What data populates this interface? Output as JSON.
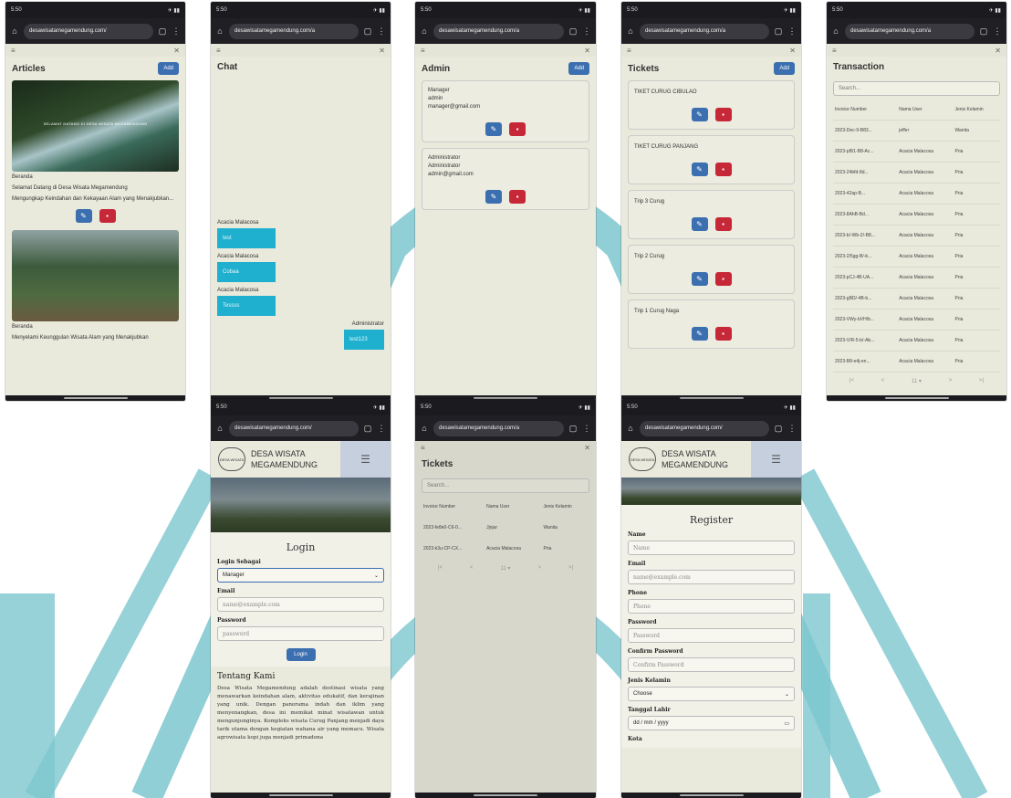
{
  "browser": {
    "url_a": "desawisatamegamendung.com/",
    "url_b": "desawisatamegamendung.com/a",
    "url_c": "desawisatamegamendung.com/a",
    "time_a": "5:50",
    "time_b": "5:50",
    "time_c": "5:50"
  },
  "articles": {
    "title": "Articles",
    "add": "Add",
    "items": [
      {
        "category": "Beranda",
        "title": "Selamat Datang di Desa Wisata Megamendung",
        "desc": "Mengungkap Keindahan dan Kekayaan Alam yang Menakjubkan...",
        "img_caption": "SELAMAT DATANG DI DESA WISATA MEGAMENDUNG"
      },
      {
        "category": "Beranda",
        "title": "Menyelami Keunggulan Wisata Alam yang Menakjubkan",
        "desc": ""
      }
    ]
  },
  "chat": {
    "title": "Chat",
    "messages": [
      {
        "sender": "Acacia Malacosa",
        "text": "test"
      },
      {
        "sender": "Acacia Malacosa",
        "text": "Cobaa"
      },
      {
        "sender": "Acacia Malacosa",
        "text": "Tessss"
      }
    ],
    "reply": {
      "sender": "Administrator",
      "text": "test123"
    }
  },
  "admin": {
    "title": "Admin",
    "add": "Add",
    "items": [
      {
        "name": "Manager",
        "role": "admin",
        "email": "manager@gmail.com"
      },
      {
        "name": "Administrator",
        "role": "Administrator",
        "email": "admin@gmail.com"
      }
    ]
  },
  "tickets": {
    "title": "Tickets",
    "add": "Add",
    "items": [
      "TIKET CURUG CIBULAO",
      "TIKET CURUG PANJANG",
      "Trip 3 Curug",
      "Trip 2 Curug",
      "Trip 1 Curug Naga"
    ]
  },
  "transaction": {
    "title": "Transaction",
    "search_placeholder": "Search...",
    "headers": [
      "Invoice Number",
      "Nama User",
      "Jenis Kelamin"
    ],
    "rows": [
      [
        "2023-Dec-9-B83...",
        "jeffer",
        "Wanita"
      ],
      [
        "2023-pB/1-B8-Ac...",
        "Acacia Malacosa",
        "Pria"
      ],
      [
        "2023-24bfd-8d...",
        "Acacia Malacosa",
        "Pria"
      ],
      [
        "2023-42ap-B...",
        "Acacia Malacosa",
        "Pria"
      ],
      [
        "2023-8AhB-Bd...",
        "Acacia Malacosa",
        "Pria"
      ],
      [
        "2023-b/-Wb-2/-B8...",
        "Acacia Malacosa",
        "Pria"
      ],
      [
        "2023-2/5gg-B/-b...",
        "Acacia Malacosa",
        "Pria"
      ],
      [
        "2023-pCJ-4B-UA...",
        "Acacia Malacosa",
        "Pria"
      ],
      [
        "2023-gBD/-4B-b...",
        "Acacia Malacosa",
        "Pria"
      ],
      [
        "2023-VWy-bVH/b...",
        "Acacia Malacosa",
        "Pria"
      ],
      [
        "2023-V/R-5-b/-Ab...",
        "Acacia Malacosa",
        "Pria"
      ],
      [
        "2023-B8-e4j-en...",
        "Acacia Malacosa",
        "Pria"
      ]
    ],
    "pager": [
      "|<",
      "<",
      "11 ▾",
      ">",
      ">|"
    ]
  },
  "site": {
    "name_line1": "DESA WISATA",
    "name_line2": "MEGAMENDUNG",
    "logo_text": "DESA WISATA"
  },
  "login": {
    "title": "Login",
    "as_label": "Login Sebagai",
    "as_value": "Manager",
    "email_label": "Email",
    "email_placeholder": "name@example.com",
    "password_label": "Password",
    "password_placeholder": "password",
    "button": "Login",
    "about_title": "Tentang Kami",
    "about_text": "Desa Wisata Megamendung adalah destinasi wisata yang menawarkan keindahan alam, aktivitas edukatif, dan kerajinan yang unik. Dengan panorama indah dan iklim yang menyenangkan, desa ini memikat minat wisatawan untuk mengunjunginya. Kompleks wisata Curug Panjang menjadi daya tarik utama dengan kegiatan wahana air yang memacu. Wisata agrowisata kopi juga menjadi primadona"
  },
  "tickets2": {
    "title": "Tickets",
    "search_placeholder": "Search...",
    "headers": [
      "Invoice Number",
      "Nama User",
      "Jenis Kelamin"
    ],
    "rows": [
      [
        "2023-fe8e0-C6-0...",
        "Jjojur",
        "Wanita"
      ],
      [
        "2023-k3u-CP-CX...",
        "Acacia Malacosa",
        "Pria"
      ]
    ],
    "pager": [
      "|<",
      "<",
      "11 ▾",
      ">",
      ">|"
    ]
  },
  "register": {
    "title": "Register",
    "fields": [
      {
        "label": "Name",
        "placeholder": "Name"
      },
      {
        "label": "Email",
        "placeholder": "name@example.com"
      },
      {
        "label": "Phone",
        "placeholder": "Phone"
      },
      {
        "label": "Password",
        "placeholder": "Password"
      },
      {
        "label": "Confirm Password",
        "placeholder": "Confirm Password"
      }
    ],
    "gender_label": "Jenis Kelamin",
    "gender_value": "Choose",
    "dob_label": "Tanggal Lahir",
    "dob_placeholder": "dd / mm / yyyy",
    "city_label": "Kota"
  },
  "colors": {
    "accent_teal": "#6cc3cb",
    "button_blue": "#3b6fb0",
    "button_red": "#c62838",
    "chat_bubble": "#1fb0cf"
  }
}
